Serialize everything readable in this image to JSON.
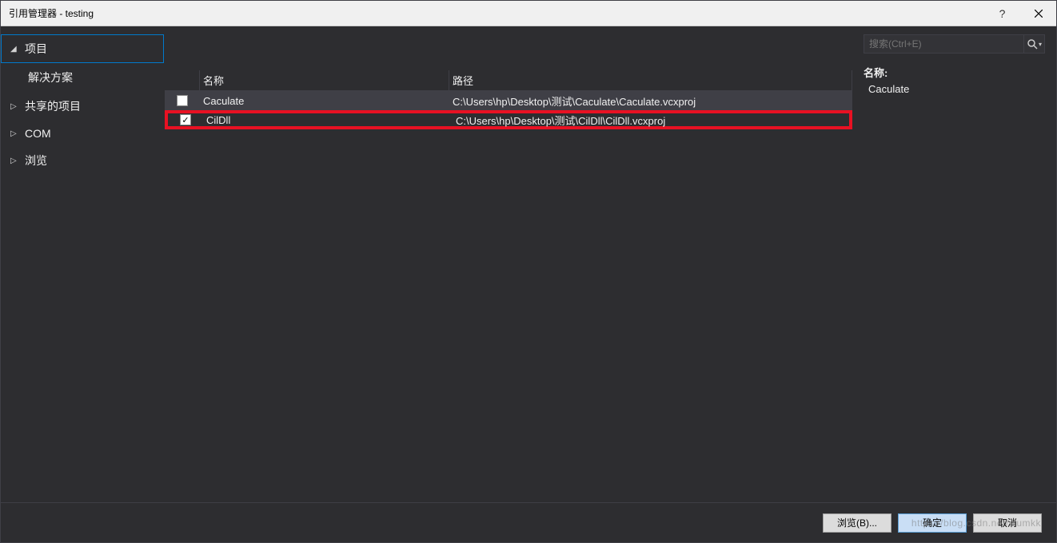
{
  "title": "引用管理器 - testing",
  "sidebar": {
    "items": [
      {
        "label": "项目",
        "expanded": true,
        "selected": true
      },
      {
        "label": "解决方案",
        "sub": true
      },
      {
        "label": "共享的项目",
        "expanded": false
      },
      {
        "label": "COM",
        "expanded": false
      },
      {
        "label": "浏览",
        "expanded": false
      }
    ]
  },
  "columns": {
    "name": "名称",
    "path": "路径"
  },
  "rows": [
    {
      "checked": false,
      "name": "Caculate",
      "path": "C:\\Users\\hp\\Desktop\\测试\\Caculate\\Caculate.vcxproj",
      "selected": true,
      "highlighted": false
    },
    {
      "checked": true,
      "name": "CilDll",
      "path": "C:\\Users\\hp\\Desktop\\测试\\CilDll\\CilDll.vcxproj",
      "selected": false,
      "highlighted": true
    }
  ],
  "search": {
    "placeholder": "搜索(Ctrl+E)"
  },
  "detail": {
    "label": "名称:",
    "value": "Caculate"
  },
  "footer": {
    "browse": "浏览(B)...",
    "ok": "确定",
    "cancel": "取消"
  },
  "watermark": "https://blog.csdn.net/xiumkk"
}
